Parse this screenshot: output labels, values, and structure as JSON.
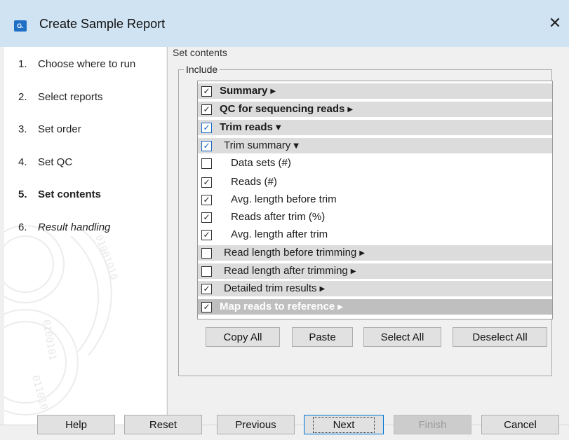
{
  "window": {
    "title": "Create Sample Report",
    "icon_text": "G."
  },
  "steps": [
    {
      "num": "1.",
      "label": "Choose where to run",
      "state": "normal"
    },
    {
      "num": "2.",
      "label": "Select reports",
      "state": "normal"
    },
    {
      "num": "3.",
      "label": "Set order",
      "state": "normal"
    },
    {
      "num": "4.",
      "label": "Set QC",
      "state": "normal"
    },
    {
      "num": "5.",
      "label": "Set contents",
      "state": "active"
    },
    {
      "num": "6.",
      "label": "Result handling",
      "state": "italic"
    }
  ],
  "main": {
    "section_title": "Set contents",
    "group_label": "Include",
    "items": [
      {
        "label": "Summary",
        "checked": true,
        "expand": "collapsed",
        "style": "bold",
        "bg": "gray",
        "indent": 0
      },
      {
        "label": "QC for sequencing reads",
        "checked": true,
        "expand": "collapsed",
        "style": "bold",
        "bg": "gray",
        "indent": 0
      },
      {
        "label": "Trim reads",
        "checked": true,
        "expand": "expanded",
        "style": "bold",
        "bg": "gray",
        "indent": 0,
        "blue": true
      },
      {
        "label": "Trim summary",
        "checked": true,
        "expand": "expanded",
        "style": "normal",
        "bg": "gray",
        "indent": 1,
        "blue": true
      },
      {
        "label": "Data sets (#)",
        "checked": false,
        "expand": "none",
        "style": "normal",
        "bg": "white",
        "indent": 2
      },
      {
        "label": "Reads (#)",
        "checked": true,
        "expand": "none",
        "style": "normal",
        "bg": "white",
        "indent": 2
      },
      {
        "label": "Avg. length before trim",
        "checked": true,
        "expand": "none",
        "style": "normal",
        "bg": "white",
        "indent": 2
      },
      {
        "label": "Reads after trim (%)",
        "checked": true,
        "expand": "none",
        "style": "normal",
        "bg": "white",
        "indent": 2
      },
      {
        "label": "Avg. length after trim",
        "checked": true,
        "expand": "none",
        "style": "normal",
        "bg": "white",
        "indent": 2
      },
      {
        "label": "Read length before trimming",
        "checked": false,
        "expand": "collapsed",
        "style": "normal",
        "bg": "gray",
        "indent": 1
      },
      {
        "label": "Read length after trimming",
        "checked": false,
        "expand": "collapsed",
        "style": "normal",
        "bg": "gray",
        "indent": 1
      },
      {
        "label": "Detailed trim results",
        "checked": true,
        "expand": "collapsed",
        "style": "normal",
        "bg": "gray",
        "indent": 1
      },
      {
        "label": "Map reads to reference",
        "checked": true,
        "expand": "collapsed",
        "style": "disabled",
        "bg": "gray",
        "indent": 0
      }
    ],
    "buttons": {
      "copy_all": "Copy All",
      "paste": "Paste",
      "select_all": "Select All",
      "deselect_all": "Deselect All"
    }
  },
  "footer": {
    "help": "Help",
    "reset": "Reset",
    "previous": "Previous",
    "next": "Next",
    "finish": "Finish",
    "cancel": "Cancel"
  },
  "colors": {
    "titlebar": "#cfe3f3",
    "accent": "#1565c0",
    "row_gray": "#dcdcdc"
  }
}
